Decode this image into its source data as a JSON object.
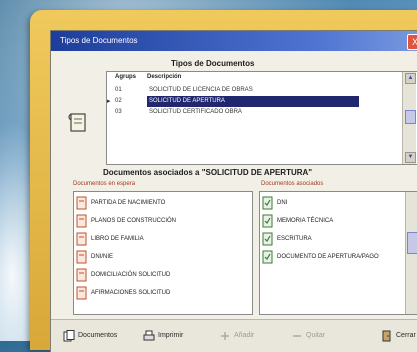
{
  "window": {
    "title": "Tipos de Documentos",
    "close_label": "X"
  },
  "types_section": {
    "title": "Tipos de Documentos",
    "col_agrup": "Agrups",
    "col_desc": "Descripción",
    "rows": [
      {
        "code": "01",
        "desc": "SOLICITUD DE LICENCIA DE OBRAS",
        "selected": false
      },
      {
        "code": "02",
        "desc": "SOLICITUD DE APERTURA",
        "selected": true
      },
      {
        "code": "03",
        "desc": "SOLICITUD CERTIFICADO OBRA",
        "selected": false
      }
    ]
  },
  "assoc_title": "Documentos asociados a \"SOLICITUD DE APERTURA\"",
  "left_panel": {
    "label": "Documentos en espera",
    "items": [
      "PARTIDA DE NACIMIENTO",
      "PLANOS DE CONSTRUCCIÓN",
      "LIBRO DE FAMILIA",
      "DNI/NIE",
      "DOMICILIACIÓN SOLICITUD",
      "AFIRMACIONES SOLICITUD"
    ]
  },
  "right_panel": {
    "label": "Documentos asociados",
    "items": [
      "DNI",
      "MEMORIA TÉCNICA",
      "ESCRITURA",
      "DOCUMENTO DE APERTURA/PAGO"
    ]
  },
  "buttons": [
    {
      "label": "Documentos",
      "icon": "documents-icon",
      "enabled": true
    },
    {
      "label": "Imprimir",
      "icon": "printer-icon",
      "enabled": true
    },
    {
      "label": "Añadir",
      "icon": "add-icon",
      "enabled": false
    },
    {
      "label": "Quitar",
      "icon": "remove-icon",
      "enabled": false
    },
    {
      "label": "Cerrar",
      "icon": "close-door-icon",
      "enabled": true
    }
  ],
  "colors": {
    "frame": "#e3b446",
    "titlebar": "#1d3d9a",
    "selection": "#20276e"
  }
}
